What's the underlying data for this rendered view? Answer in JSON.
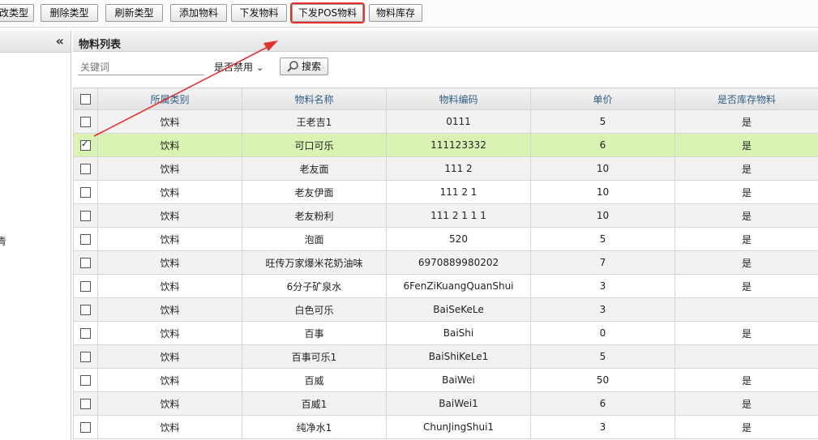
{
  "toolbar": {
    "buttons": [
      "改类型",
      "删除类型",
      "刷新类型",
      "添加物料",
      "下发物料",
      "下发POS物料",
      "物料库存"
    ],
    "highlight_color": "#e53030"
  },
  "left_panel": {
    "collapse_glyph": "«",
    "cut_label": "青"
  },
  "main": {
    "title": "物料列表",
    "search": {
      "keyword_placeholder": "关键词",
      "disable_select": "是否禁用",
      "search_button": "搜索"
    }
  },
  "table": {
    "headers": [
      "所属类别",
      "物料名称",
      "物料编码",
      "单价",
      "是否库存物料"
    ],
    "rows": [
      {
        "cat": "饮料",
        "name": "王老吉1",
        "code": "0111",
        "price": "5",
        "stock": "是",
        "checked": false
      },
      {
        "cat": "饮料",
        "name": "可口可乐",
        "code": "111123332",
        "price": "6",
        "stock": "是",
        "checked": true
      },
      {
        "cat": "饮料",
        "name": "老友面",
        "code": "111 2",
        "price": "10",
        "stock": "是",
        "checked": false
      },
      {
        "cat": "饮料",
        "name": "老友伊面",
        "code": "111 2  1",
        "price": "10",
        "stock": "是",
        "checked": false
      },
      {
        "cat": "饮料",
        "name": "老友粉利",
        "code": "111 2  1  1  1",
        "price": "10",
        "stock": "是",
        "checked": false
      },
      {
        "cat": "饮料",
        "name": "泡面",
        "code": "520",
        "price": "5",
        "stock": "是",
        "checked": false
      },
      {
        "cat": "饮料",
        "name": "旺传万家爆米花奶油味",
        "code": "6970889980202",
        "price": "7",
        "stock": "是",
        "checked": false
      },
      {
        "cat": "饮料",
        "name": "6分子矿泉水",
        "code": "6FenZiKuangQuanShui",
        "price": "3",
        "stock": "是",
        "checked": false
      },
      {
        "cat": "饮料",
        "name": "白色可乐",
        "code": "BaiSeKeLe",
        "price": "3",
        "stock": "",
        "checked": false
      },
      {
        "cat": "饮料",
        "name": "百事",
        "code": "BaiShi",
        "price": "0",
        "stock": "是",
        "checked": false
      },
      {
        "cat": "饮料",
        "name": "百事可乐1",
        "code": "BaiShiKeLe1",
        "price": "5",
        "stock": "",
        "checked": false
      },
      {
        "cat": "饮料",
        "name": "百威",
        "code": "BaiWei",
        "price": "50",
        "stock": "是",
        "checked": false
      },
      {
        "cat": "饮料",
        "name": "百威1",
        "code": "BaiWei1",
        "price": "6",
        "stock": "是",
        "checked": false
      },
      {
        "cat": "饮料",
        "name": "纯净水1",
        "code": "ChunJingShui1",
        "price": "3",
        "stock": "是",
        "checked": false
      }
    ],
    "selected_color": "#d9f3b3",
    "alt_color": "#f2f2f2"
  }
}
